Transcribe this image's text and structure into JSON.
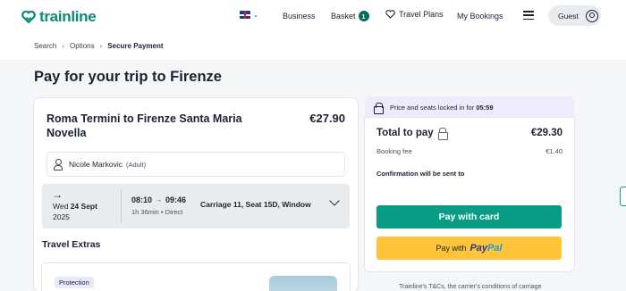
{
  "header": {
    "logo_text": "trainline",
    "nav": {
      "business": "Business",
      "basket": "Basket",
      "basket_count": "1",
      "travel_plans": "Travel Plans",
      "my_bookings": "My Bookings",
      "guest": "Guest"
    }
  },
  "breadcrumb": {
    "items": [
      "Search",
      "Options",
      "Secure Payment"
    ]
  },
  "page": {
    "title": "Pay for your trip to Firenze"
  },
  "journey": {
    "route": "Roma Termini to Firenze Santa Maria Novella",
    "price": "€27.90",
    "passenger_name": "Nicole Markovic",
    "passenger_type": "(Adult)",
    "leg": {
      "arrow": "→",
      "weekday": "Wed",
      "date": "24 Sept",
      "year": "2025",
      "depart": "08:10",
      "arrive": "09:46",
      "duration": "1h 36min • Direct",
      "seat": "Carriage 11, Seat 15D, Window"
    }
  },
  "extras": {
    "title": "Travel Extras",
    "badge": "Protection"
  },
  "payment": {
    "lock_text": "Price and seats locked in for",
    "lock_time": "05:59",
    "total_label": "Total to pay",
    "total_value": "€29.30",
    "booking_fee_label": "Booking fee",
    "booking_fee_value": "€1.40",
    "confirmation": "Confirmation will be sent to",
    "pay_card": "Pay with card",
    "pay_with": "Pay with",
    "paypal_pay": "Pay",
    "paypal_pal": "Pal"
  },
  "footer": {
    "terms": "Trainline's T&Cs, the carrier's conditions of carriage"
  },
  "colors": {
    "brand": "#0a8a77",
    "pay_button": "#0a9d85",
    "paypal_button": "#ffc439",
    "lock_bar": "#eeecfb"
  }
}
